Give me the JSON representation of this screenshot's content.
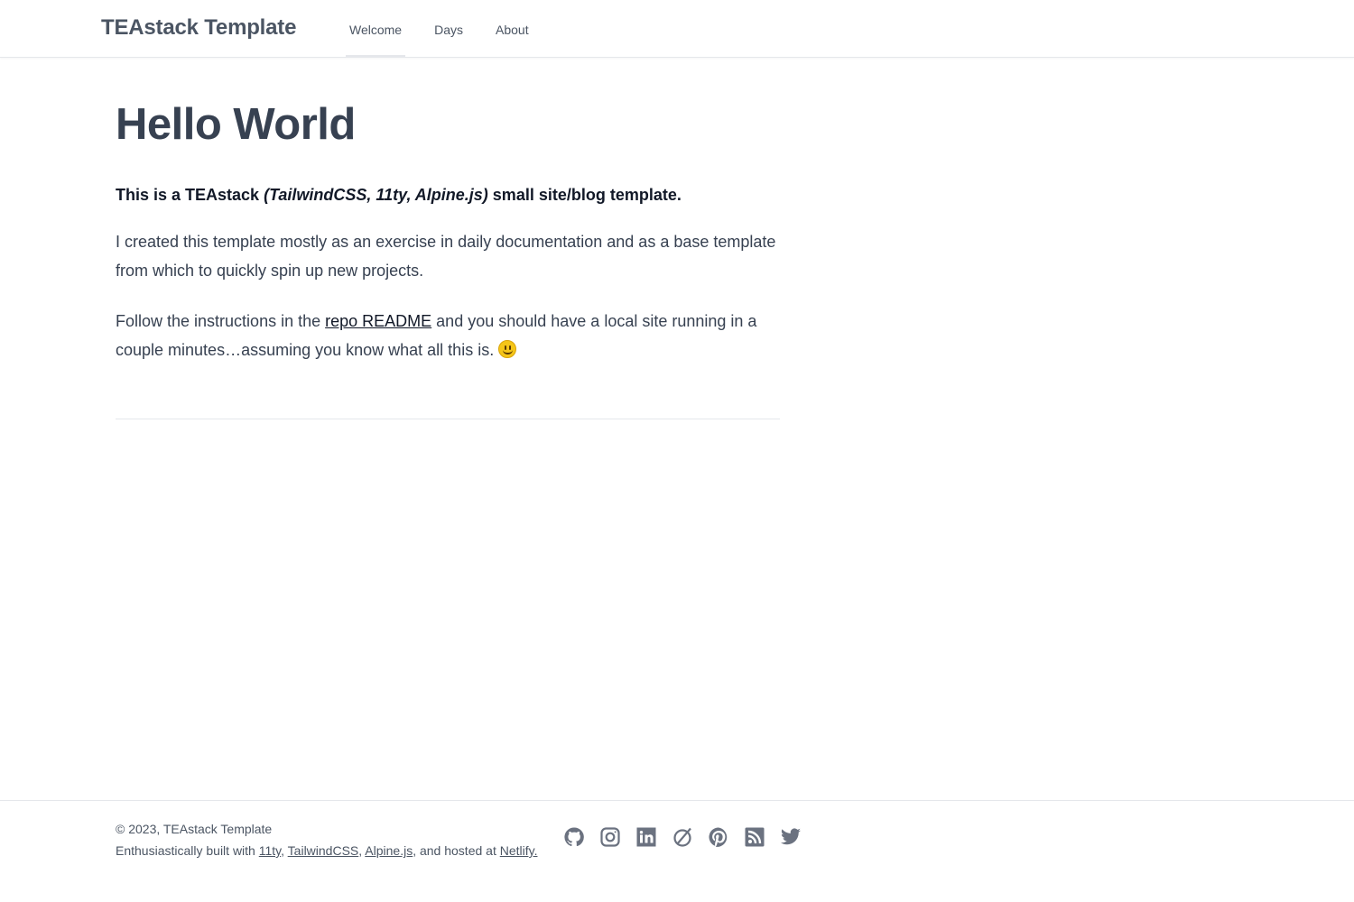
{
  "header": {
    "brand": "TEAstack Template",
    "nav": [
      {
        "label": "Welcome"
      },
      {
        "label": "Days"
      },
      {
        "label": "About"
      }
    ]
  },
  "main": {
    "title": "Hello World",
    "lead_before": "This is a TEAstack ",
    "lead_em": "(TailwindCSS, 11ty, Alpine.js)",
    "lead_after": " small site/blog template.",
    "para1": "I created this template mostly as an exercise in daily documentation and as a base template from which to quickly spin up new projects.",
    "para2_before": "Follow the instructions in the ",
    "para2_link": "repo README",
    "para2_after": " and you should have a local site running in a couple minutes…assuming you know what all this is. "
  },
  "footer": {
    "copyright": "© 2023, TEAstack Template",
    "built_prefix": "Enthusiastically built with ",
    "link_11ty": "11ty",
    "sep1": ", ",
    "link_tailwind": "TailwindCSS",
    "sep2": ", ",
    "link_alpine": "Alpine.js",
    "hosted": ", and hosted at ",
    "link_netlify": "Netlify.",
    "social_icons": [
      "github-icon",
      "instagram-icon",
      "linkedin-icon",
      "letterboxd-icon",
      "pinterest-icon",
      "rss-icon",
      "twitter-icon"
    ]
  },
  "colors": {
    "text": "#374151",
    "muted": "#4b5563",
    "icon": "#6b7280",
    "border": "#e5e7eb"
  }
}
